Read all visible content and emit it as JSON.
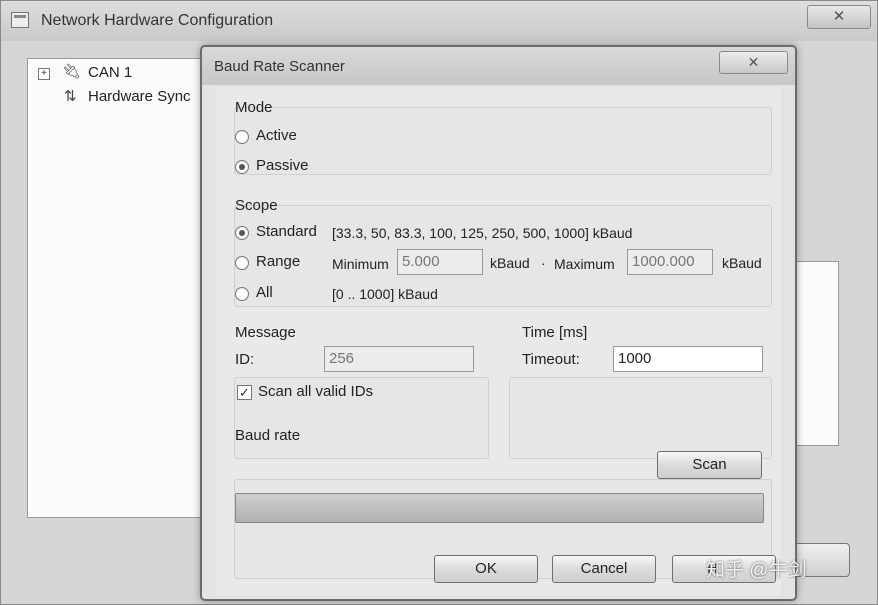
{
  "main_window": {
    "title": "Network Hardware Configuration",
    "close_glyph": "✕",
    "tree": [
      {
        "label": "CAN 1",
        "icon": "plug-icon"
      },
      {
        "label": "Hardware Sync",
        "icon": "sync-icon"
      }
    ]
  },
  "dialog": {
    "title": "Baud Rate Scanner",
    "close_glyph": "✕",
    "mode": {
      "label": "Mode",
      "options": [
        "Active",
        "Passive"
      ],
      "selected": "Passive"
    },
    "scope": {
      "label": "Scope",
      "standard_label": "Standard",
      "standard_values": "[33.3, 50, 83.3, 100, 125, 250, 500, 1000] kBaud",
      "range_label": "Range",
      "minimum_label": "Minimum",
      "minimum_value": "5.000",
      "minimum_unit": "kBaud",
      "separator": "·",
      "maximum_label": "Maximum",
      "maximum_value": "1000.000",
      "maximum_unit": "kBaud",
      "all_label": "All",
      "all_values": "[0 .. 1000] kBaud",
      "selected": "Standard"
    },
    "message": {
      "label": "Message",
      "id_label": "ID:",
      "id_value": "256",
      "scan_all_label": "Scan all valid IDs",
      "scan_all_checked": true
    },
    "time": {
      "label": "Time [ms]",
      "timeout_label": "Timeout:",
      "timeout_value": "1000"
    },
    "baud_rate": {
      "label": "Baud rate",
      "scan_button": "Scan",
      "progress": 1.0
    },
    "buttons": {
      "ok": "OK",
      "cancel": "Cancel",
      "help": "H"
    }
  },
  "watermark": "知乎 @牛剑"
}
